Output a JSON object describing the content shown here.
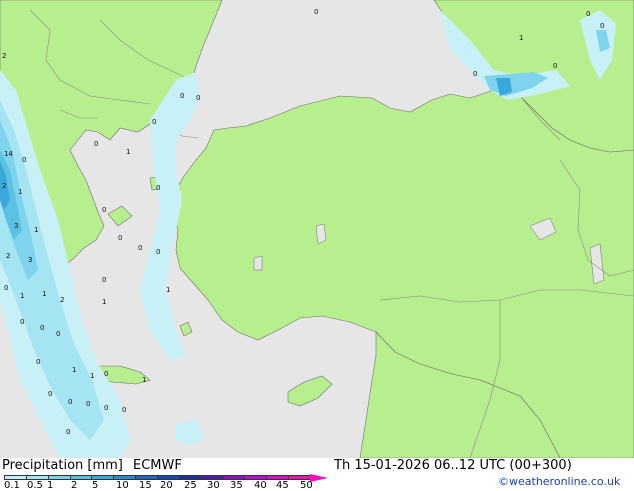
{
  "legend": {
    "title": "Precipitation [mm]",
    "model": "ECMWF",
    "ticks": [
      "0.1",
      "0.5",
      "1",
      "2",
      "5",
      "10",
      "15",
      "20",
      "25",
      "30",
      "35",
      "40",
      "45",
      "50"
    ],
    "colors": [
      "#c8f0f7",
      "#a5e4f2",
      "#80d3ec",
      "#5cc2e3",
      "#3aa8d9",
      "#2b8bd1",
      "#1f68c4",
      "#1747b4",
      "#1e2f9c",
      "#4d1ab0",
      "#8a12c4",
      "#b80fd0",
      "#d80fc8",
      "#ee14b8"
    ]
  },
  "valid_time": "Th 15-01-2026 06..12 UTC (00+300)",
  "credit": "©weatheronline.co.uk",
  "map": {
    "colors": {
      "sea": "#e6e6e6",
      "land": "#b7ef8f",
      "border": "#8a8a8a",
      "coast": "#6f6f6f"
    },
    "point_values": [
      "0",
      "1",
      "0",
      "0",
      "0",
      "0",
      "2",
      "0",
      "0",
      "0",
      "0",
      "14",
      "0",
      "2",
      "1",
      "1",
      "0",
      "0",
      "3",
      "1",
      "0",
      "2",
      "3",
      "0",
      "0",
      "0",
      "1",
      "2",
      "1",
      "0",
      "1",
      "1",
      "0",
      "0",
      "0",
      "1",
      "0",
      "1",
      "0",
      "0",
      "1",
      "0",
      "0",
      "0",
      "0",
      "0"
    ]
  }
}
